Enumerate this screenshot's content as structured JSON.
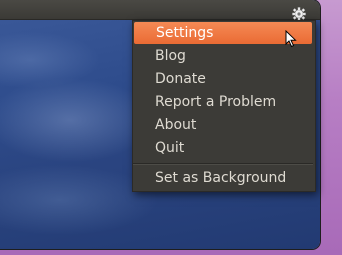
{
  "panel": {
    "gear_icon": "gear-icon"
  },
  "menu": {
    "items": [
      {
        "label": "Settings",
        "active": true
      },
      {
        "label": "Blog"
      },
      {
        "label": "Donate"
      },
      {
        "label": "Report a Problem"
      },
      {
        "label": "About"
      },
      {
        "label": "Quit"
      }
    ],
    "extra_item": {
      "label": "Set as Background"
    }
  },
  "colors": {
    "highlight": "#ea6b34",
    "menu_bg": "#3c3b37",
    "menu_text": "#dfdbd2"
  }
}
